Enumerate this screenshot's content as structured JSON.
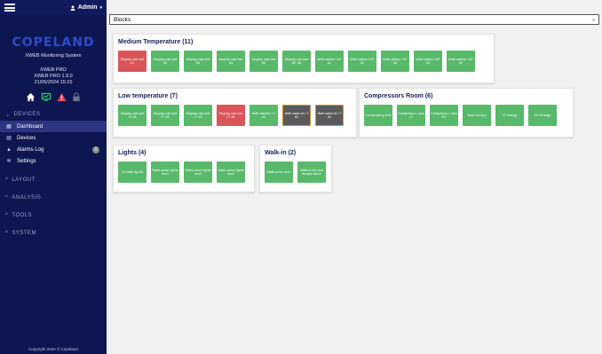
{
  "header": {
    "user_label": "Admin"
  },
  "sidebar": {
    "logo": "COPELAND",
    "subtitle": "XWEB Monitoring System",
    "info_line1": "XWEB PRO",
    "info_line2": "XWEB PRO 1.9.0",
    "info_line3": "21/05/2024 15:15",
    "devices_section": "DEVICES",
    "items": [
      {
        "label": "Dashboard",
        "icon": "grid-icon"
      },
      {
        "label": "Devices",
        "icon": "devices-icon"
      },
      {
        "label": "Alarms Log",
        "icon": "alarm-icon",
        "badge": "0"
      },
      {
        "label": "Settings",
        "icon": "gear-icon"
      }
    ],
    "sections": [
      "LAYOUT",
      "ANALYSIS",
      "TOOLS",
      "SYSTEM"
    ],
    "copyright": "Copyright 2024 © Copeland"
  },
  "select": {
    "value": "Blocks"
  },
  "panels": {
    "medium": {
      "title": "Medium Temperature (11)",
      "tiles": [
        {
          "label": "Display cab inet #1",
          "state": "alarm"
        },
        {
          "label": "Display cab inet #2",
          "state": "ok"
        },
        {
          "label": "Display cab inet #3",
          "state": "ok"
        },
        {
          "label": "Display cab inet #4",
          "state": "ok"
        },
        {
          "label": "Display cab inet #5",
          "state": "ok"
        },
        {
          "label": "Display cab inet MT #6",
          "state": "ok"
        },
        {
          "label": "Wall cabine t NT #1",
          "state": "ok"
        },
        {
          "label": "Wall cabine t NT #2",
          "state": "ok"
        },
        {
          "label": "Wall cabine t NT #4",
          "state": "ok"
        },
        {
          "label": "Wall cabine t NT #3",
          "state": "ok"
        },
        {
          "label": "Wall cabine t NT #5",
          "state": "ok"
        }
      ]
    },
    "low": {
      "title": "Low temperature (7)",
      "tiles": [
        {
          "label": "Display cab inet LT #1",
          "state": "ok"
        },
        {
          "label": "Display cab inet LT #2",
          "state": "ok"
        },
        {
          "label": "Display cab inet LT #3",
          "state": "ok"
        },
        {
          "label": "Display cab inet LT #4",
          "state": "alarm"
        },
        {
          "label": "Wall cabine t LT #1",
          "state": "ok"
        },
        {
          "label": "Wall cabin et LT #2",
          "state": "offline"
        },
        {
          "label": "Wall cabin et LT #3",
          "state": "offline"
        }
      ]
    },
    "compressors": {
      "title": "Compressors Room (6)",
      "tiles": [
        {
          "label": "Condensin g Unit",
          "state": "ok"
        },
        {
          "label": "Compresso r rack LT",
          "state": "ok"
        },
        {
          "label": "Compresso r rack NT",
          "state": "ok"
        },
        {
          "label": "Total energ y",
          "state": "ok"
        },
        {
          "label": "LT energy",
          "state": "ok"
        },
        {
          "label": "NT Energy",
          "state": "ok"
        }
      ]
    },
    "lights": {
      "title": "Lights (4)",
      "tiles": [
        {
          "label": "Counter lig hts",
          "state": "ok"
        },
        {
          "label": "Sales area l ights row1",
          "state": "ok"
        },
        {
          "label": "Sales area l ights row2",
          "state": "ok"
        },
        {
          "label": "Sales area l ights row3",
          "state": "ok"
        }
      ]
    },
    "walkin": {
      "title": "Walk-in (2)",
      "tiles": [
        {
          "label": "Walk-in fre ezer",
          "state": "ok"
        },
        {
          "label": "Walk-in fler mal temper ature",
          "state": "ok"
        }
      ]
    }
  },
  "colors": {
    "sidebar_bg": "#0d1650",
    "tile_ok": "#58b96a",
    "tile_alarm": "#d9555a",
    "tile_offline": "#5a5a5a",
    "accent": "#2d4cc8"
  }
}
